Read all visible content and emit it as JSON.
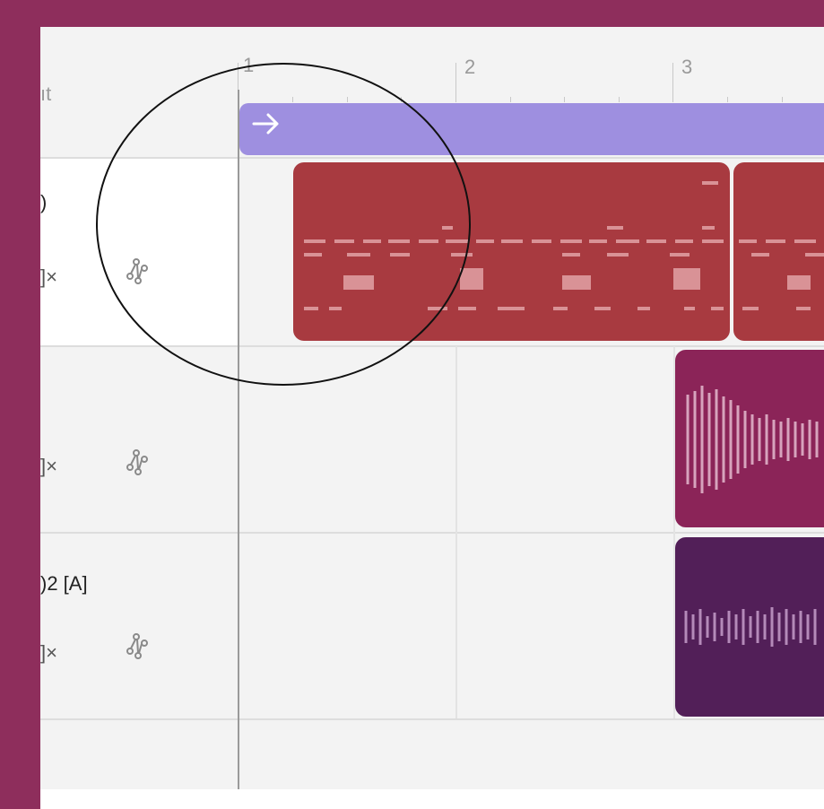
{
  "ruler": {
    "bars": [
      "1",
      "2",
      "3"
    ]
  },
  "header": {
    "partial_label": "ıt"
  },
  "tracks": [
    {
      "name": ")",
      "mute_label": "]×",
      "route_icon": "route-icon",
      "clip_color": "#a83a40",
      "clip_type": "midi"
    },
    {
      "name": "",
      "mute_label": "]×",
      "route_icon": "route-icon",
      "clip_color": "#8b2458",
      "clip_type": "audio"
    },
    {
      "name": ")2 [A]",
      "mute_label": "]×",
      "route_icon": "route-icon",
      "clip_color": "#521f58",
      "clip_type": "audio"
    }
  ],
  "marker": {
    "icon": "arrow-right-icon",
    "color": "#9e8fe0"
  },
  "colors": {
    "background_accent": "#8e2e5c",
    "panel": "#f3f3f3"
  }
}
